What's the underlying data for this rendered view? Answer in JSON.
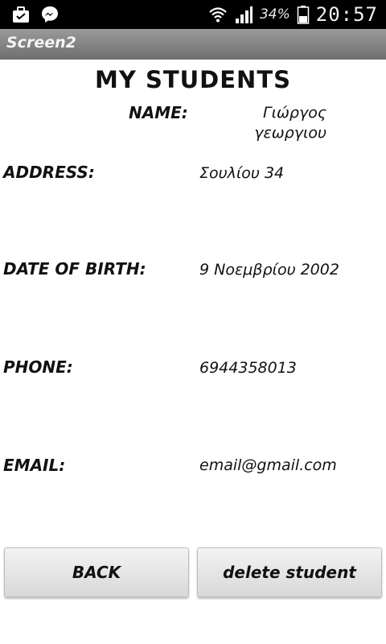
{
  "status_bar": {
    "battery_percent": "34%",
    "time": "20:57",
    "icons": [
      "briefcase-icon",
      "messenger-icon",
      "wifi-icon",
      "signal-icon",
      "battery-icon"
    ]
  },
  "app": {
    "title": "Screen2"
  },
  "main": {
    "heading": "MY STUDENTS",
    "name_label": "NAME:",
    "name_value": "Γιώργος γεωργιου",
    "address_label": "ADDRESS:",
    "address_value": "Σουλίου 34",
    "dob_label": "DATE OF BIRTH:",
    "dob_value": "9 Νοεμβρίου 2002",
    "phone_label": "PHONE:",
    "phone_value": "6944358013",
    "email_label": "EMAIL:",
    "email_value": "email@gmail.com"
  },
  "buttons": {
    "back": "BACK",
    "delete": "delete student"
  }
}
